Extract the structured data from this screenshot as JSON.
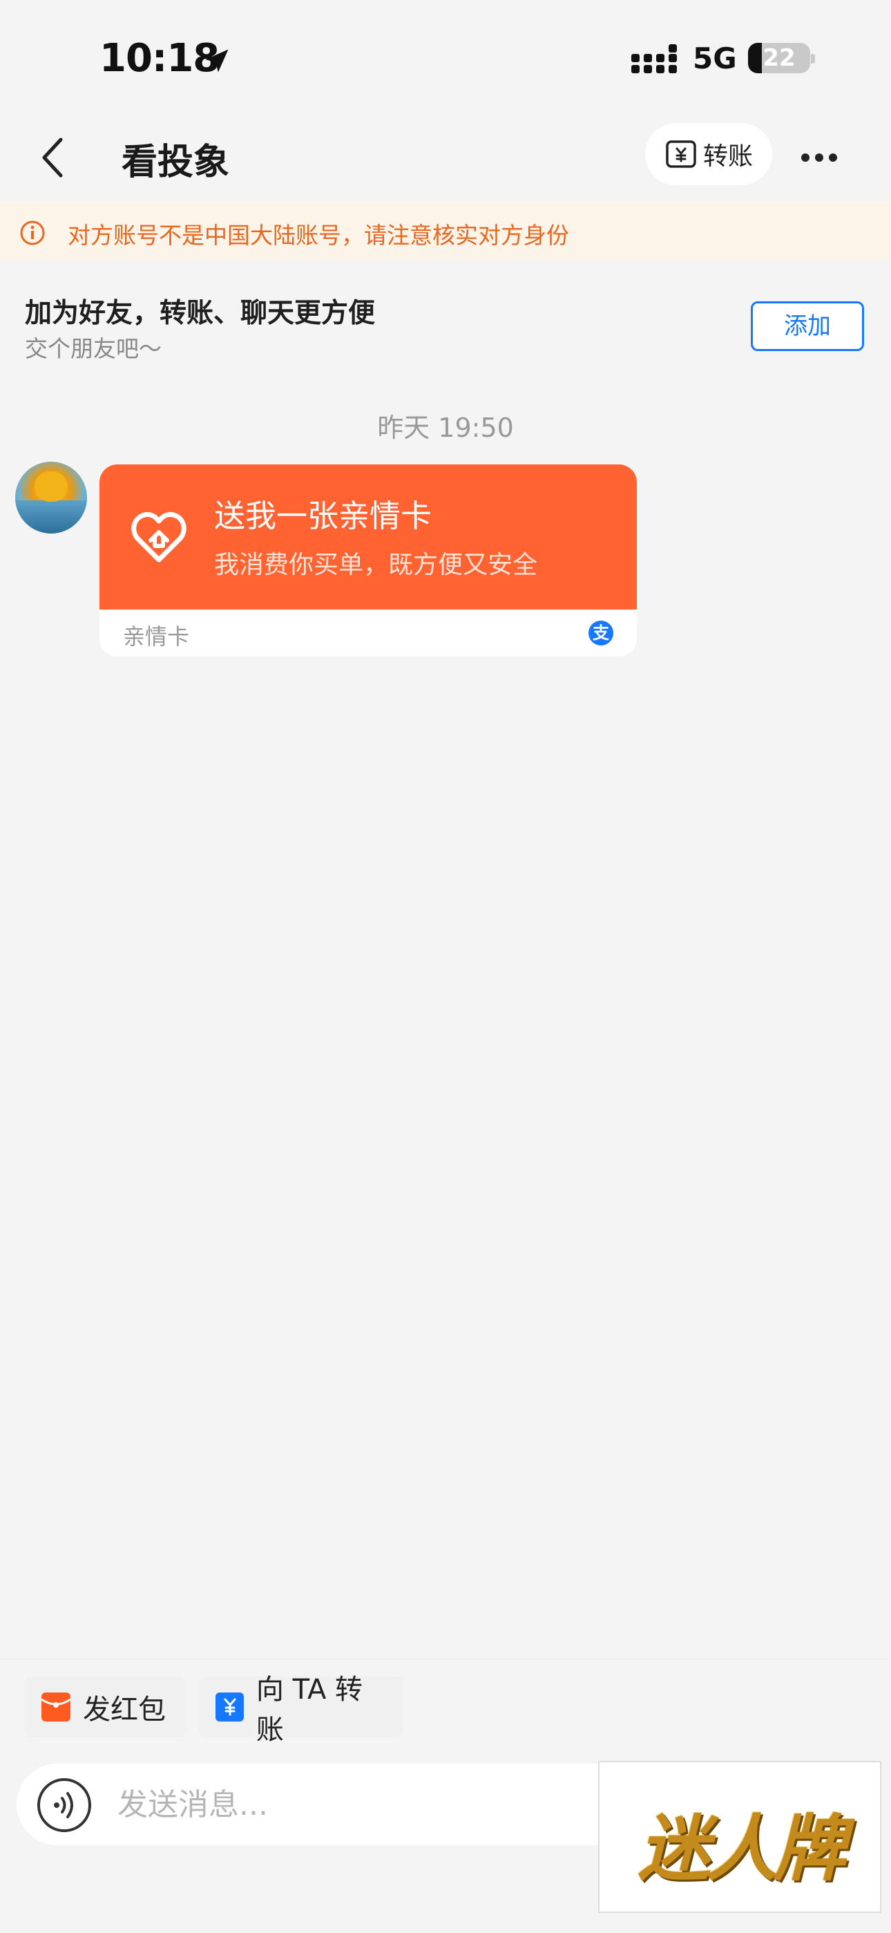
{
  "status_bar": {
    "time": "10:18",
    "network": "5G",
    "battery": "22",
    "battery_level": 0.22
  },
  "nav": {
    "title": "看投象",
    "transfer_label": "转账"
  },
  "notice": {
    "text": "对方账号不是中国大陆账号，请注意核实对方身份",
    "color": "#e9661f"
  },
  "friend_prompt": {
    "title": "加为好友，转账、聊天更方便",
    "subtitle": "交个朋友吧～",
    "add_label": "添加"
  },
  "chat": {
    "timestamp": "昨天 19:50",
    "message": {
      "title": "送我一张亲情卡",
      "description": "我消费你买单，既方便又安全",
      "footer": "亲情卡",
      "card_color": "#ff6332"
    }
  },
  "quick_actions": [
    {
      "label": "发红包",
      "icon": "red-packet-icon",
      "color": "#ff5a1f"
    },
    {
      "label": "向 TA 转账",
      "icon": "transfer-icon",
      "color": "#1677ff"
    }
  ],
  "input": {
    "placeholder": "发送消息..."
  },
  "watermark": {
    "text": "迷人牌"
  }
}
